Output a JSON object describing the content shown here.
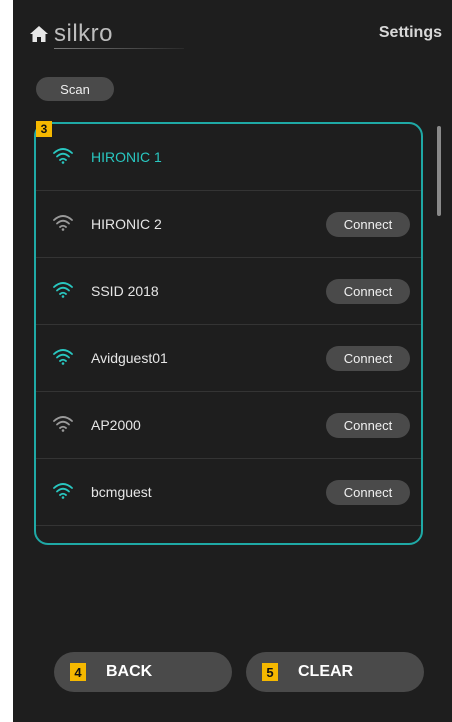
{
  "header": {
    "logo_text": "silkro",
    "settings_label": "Settings"
  },
  "scan_label": "Scan",
  "panel_badge": "3",
  "networks": [
    {
      "ssid": "HIRONIC 1",
      "connected": true,
      "signal_color": "#29c7c0",
      "connect_label": ""
    },
    {
      "ssid": "HIRONIC 2",
      "connected": false,
      "signal_color": "#9a9a9a",
      "connect_label": "Connect"
    },
    {
      "ssid": "SSID 2018",
      "connected": false,
      "signal_color": "#29c7c0",
      "connect_label": "Connect"
    },
    {
      "ssid": "Avidguest01",
      "connected": false,
      "signal_color": "#29c7c0",
      "connect_label": "Connect"
    },
    {
      "ssid": "AP2000",
      "connected": false,
      "signal_color": "#9a9a9a",
      "connect_label": "Connect"
    },
    {
      "ssid": "bcmguest",
      "connected": false,
      "signal_color": "#29c7c0",
      "connect_label": "Connect"
    }
  ],
  "footer": {
    "back_badge": "4",
    "back_label": "BACK",
    "clear_badge": "5",
    "clear_label": "CLEAR"
  },
  "colors": {
    "accent": "#1fa9a6",
    "badge": "#f5b800",
    "background": "#1e1e1e"
  },
  "icons": {
    "home": "home-icon",
    "wifi": "wifi-icon"
  }
}
